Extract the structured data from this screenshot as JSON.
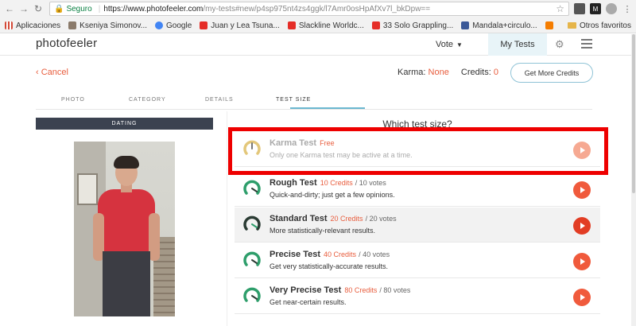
{
  "browser": {
    "secure_label": "Seguro",
    "url_main": "https://www.photofeeler.com",
    "url_rest": "/my-tests#new/p4sp975nt4zs4ggk/l7Amr0osHpAfXv7l_bkDpw==",
    "bookmarks": [
      {
        "label": "Aplicaciones",
        "color": "#d34836"
      },
      {
        "label": "Kseniya Simonov...",
        "color": "#8a7a6a"
      },
      {
        "label": "Google",
        "color": "#4285f4"
      },
      {
        "label": "Juan y Lea Tsuna...",
        "color": "#e52d27"
      },
      {
        "label": "Slackline Worldc...",
        "color": "#e52d27"
      },
      {
        "label": "33 Solo Grappling...",
        "color": "#e52d27"
      },
      {
        "label": "Mandala+circulo...",
        "color": "#3b5998"
      },
      {
        "label": "",
        "color": "#f57d00"
      }
    ],
    "other_bookmarks": "Otros favoritos"
  },
  "nav": {
    "logo": "photofeeler",
    "vote": "Vote",
    "my_tests": "My Tests"
  },
  "actions": {
    "cancel": "Cancel",
    "karma_label": "Karma:",
    "karma_value": "None",
    "credits_label": "Credits:",
    "credits_value": "0",
    "get_more_credits": "Get More Credits"
  },
  "steps": [
    "PHOTO",
    "CATEGORY",
    "DETAILS",
    "TEST SIZE"
  ],
  "category": "DATING",
  "question": "Which test size?",
  "options": [
    {
      "title": "Karma Test",
      "cost": "Free",
      "votes": "",
      "desc": "Only one Karma test may be active at a time."
    },
    {
      "title": "Rough Test",
      "cost": "10 Credits",
      "votes": "/ 10 votes",
      "desc": "Quick-and-dirty; just get a few opinions."
    },
    {
      "title": "Standard Test",
      "cost": "20 Credits",
      "votes": "/ 20 votes",
      "desc": "More statistically-relevant results."
    },
    {
      "title": "Precise Test",
      "cost": "40 Credits",
      "votes": "/ 40 votes",
      "desc": "Get very statistically-accurate results."
    },
    {
      "title": "Very Precise Test",
      "cost": "80 Credits",
      "votes": "/ 80 votes",
      "desc": "Get near-certain results."
    }
  ],
  "colors": {
    "accent": "#e85d3d",
    "go_button": "#f05a3c",
    "gauge_green": "#2e9e6b",
    "gauge_dark": "#2a3b33",
    "highlight": "#ee0000"
  }
}
